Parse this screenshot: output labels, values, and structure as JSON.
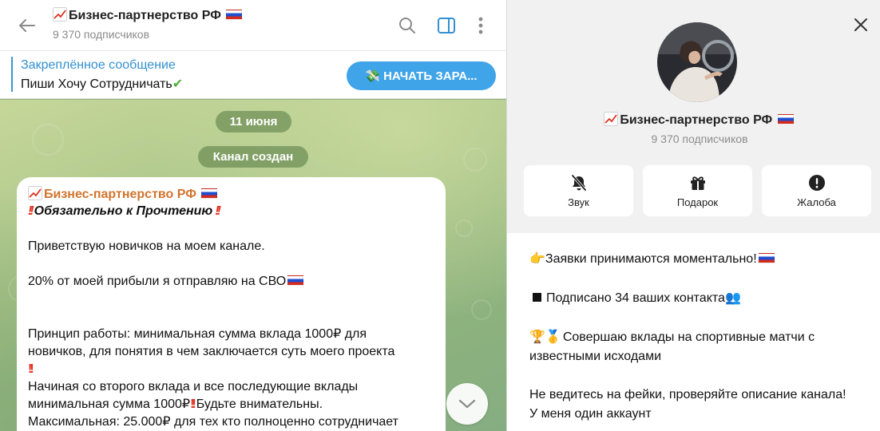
{
  "chat": {
    "header": {
      "title": "Бизнес-партнерство РФ",
      "subtitle": "9 370 подписчиков"
    },
    "pinned": {
      "title": "Закреплённое сообщение",
      "text": "Пиши Хочу Сотрудничать",
      "button": "НАЧАТЬ ЗАРА..."
    },
    "date_pill": "11 июня",
    "service_pill": "Канал создан",
    "message": {
      "sender": "Бизнес-партнерство РФ",
      "heading": "Обязательно к Прочтению",
      "p1": "Приветствую новичков на моем канале.",
      "p2": "20% от моей прибыли я отправляю на СВО",
      "p3a": "Принцип работы: минимальная сумма вклада 1000₽ для",
      "p3b": "новичков, для понятия в чем заключается суть моего проекта",
      "p4a": "Начиная со второго вклада и все последующие вклады",
      "p4b": "минимальная сумма 1000₽",
      "p4b_tail": "Будьте внимательны.",
      "p5": "Максимальная: 25.000₽ для тех кто полноценно сотрудничает"
    }
  },
  "info": {
    "title": "Бизнес-партнерство РФ",
    "subtitle": "9 370 подписчиков",
    "actions": [
      {
        "label": "Звук",
        "icon": "bell-off-icon"
      },
      {
        "label": "Подарок",
        "icon": "gift-icon"
      },
      {
        "label": "Жалоба",
        "icon": "report-icon"
      }
    ],
    "description": {
      "l1": "Заявки принимаются моментально!",
      "l2": "Подписано 34 ваших контакта",
      "l3a": "Совершаю вклады на спортивные матчи с",
      "l3b": "известными исходами",
      "l4a": "Не ведитесь на фейки, проверяйте описание канала!",
      "l4b": "У меня один аккаунт"
    }
  },
  "colors": {
    "accent": "#3390d0",
    "pinned_button": "#3fa4e8",
    "sender": "#d0752e",
    "exclamation": "#e0301e"
  }
}
